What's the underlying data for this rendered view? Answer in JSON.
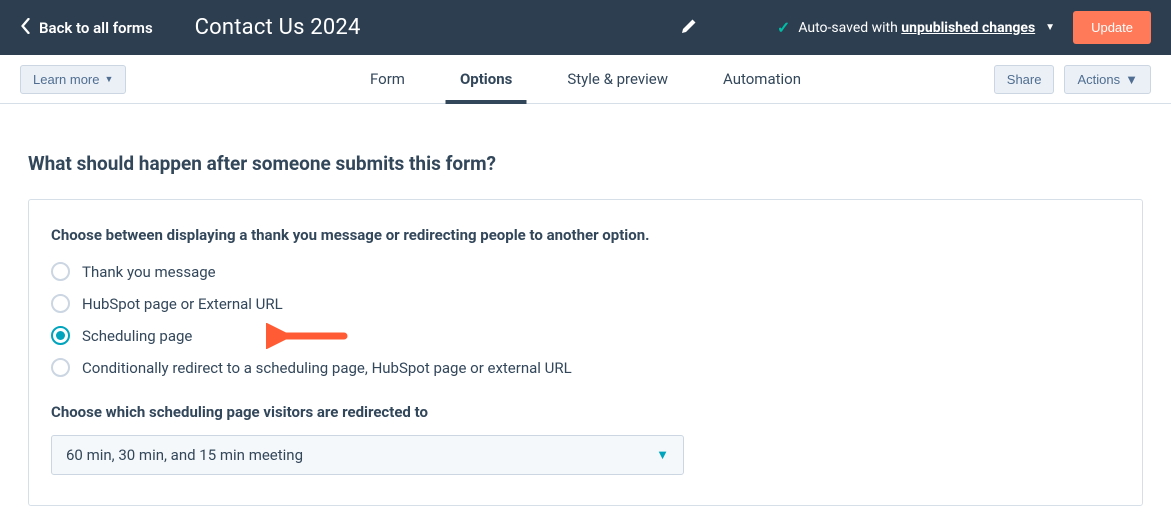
{
  "topbar": {
    "back_label": "Back to all forms",
    "title": "Contact Us 2024",
    "autosave_prefix": "Auto-saved with ",
    "autosave_emphasis": "unpublished changes",
    "update_label": "Update"
  },
  "subbar": {
    "learn_more_label": "Learn more",
    "tabs": [
      {
        "label": "Form",
        "active": false
      },
      {
        "label": "Options",
        "active": true
      },
      {
        "label": "Style & preview",
        "active": false
      },
      {
        "label": "Automation",
        "active": false
      }
    ],
    "share_label": "Share",
    "actions_label": "Actions"
  },
  "section": {
    "heading": "What should happen after someone submits this form?",
    "prompt": "Choose between displaying a thank you message or redirecting people to another option.",
    "radio_options": [
      {
        "label": "Thank you message",
        "selected": false
      },
      {
        "label": "HubSpot page or External URL",
        "selected": false
      },
      {
        "label": "Scheduling page",
        "selected": true
      },
      {
        "label": "Conditionally redirect to a scheduling page, HubSpot page or external URL",
        "selected": false
      }
    ],
    "select_label": "Choose which scheduling page visitors are redirected to",
    "dropdown_value": "60 min, 30 min, and 15 min meeting"
  },
  "colors": {
    "accent_orange": "#ff7a59",
    "accent_teal": "#00a4bd",
    "header_bg": "#2d3e50"
  }
}
